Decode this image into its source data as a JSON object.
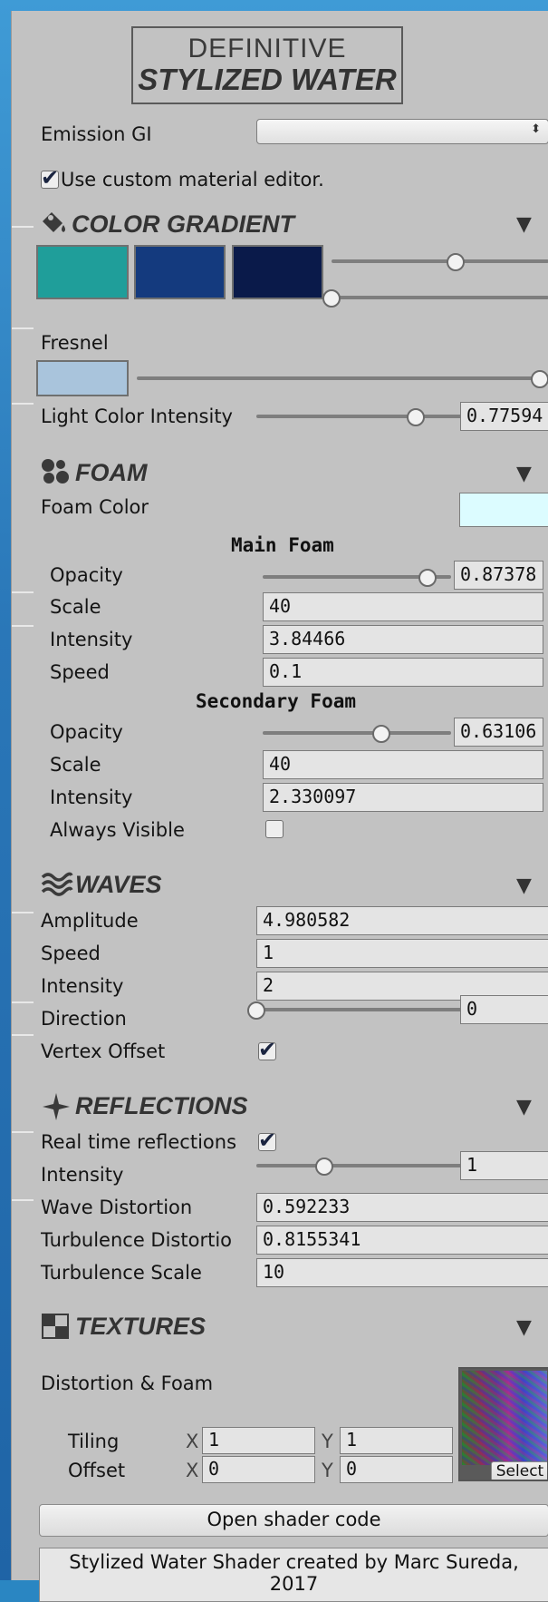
{
  "header": {
    "logo_line1": "DEFINITIVE",
    "logo_line2": "STYLIZED WATER"
  },
  "general": {
    "emission_gi_label": "Emission GI",
    "emission_gi_value": "",
    "custom_editor_label": "Use custom material editor.",
    "custom_editor_checked": true
  },
  "color_gradient": {
    "title": "COLOR GRADIENT",
    "swatches": [
      "#1f9e9a",
      "#143a7e",
      "#0a1a4a"
    ],
    "slider1": 0.57,
    "slider2": 0.0,
    "fresnel_label": "Fresnel",
    "fresnel_color": "#a9c4dc",
    "fresnel_slider": 1.0,
    "light_intensity_label": "Light Color Intensity",
    "light_intensity_value": "0.77594",
    "light_intensity_slider": 0.776
  },
  "foam": {
    "title": "FOAM",
    "color_label": "Foam Color",
    "color": "#dcfcff",
    "main_heading": "Main Foam",
    "main": {
      "opacity_label": "Opacity",
      "opacity_value": "0.87378",
      "opacity_slider": 0.874,
      "scale_label": "Scale",
      "scale_value": "40",
      "intensity_label": "Intensity",
      "intensity_value": "3.84466",
      "speed_label": "Speed",
      "speed_value": "0.1"
    },
    "secondary_heading": "Secondary Foam",
    "secondary": {
      "opacity_label": "Opacity",
      "opacity_value": "0.63106",
      "opacity_slider": 0.631,
      "scale_label": "Scale",
      "scale_value": "40",
      "intensity_label": "Intensity",
      "intensity_value": "2.330097",
      "always_visible_label": "Always Visible",
      "always_visible_checked": false
    }
  },
  "waves": {
    "title": "WAVES",
    "amplitude_label": "Amplitude",
    "amplitude_value": "4.980582",
    "speed_label": "Speed",
    "speed_value": "1",
    "intensity_label": "Intensity",
    "intensity_value": "2",
    "direction_label": "Direction",
    "direction_value": "0",
    "direction_slider": 0.0,
    "vertex_offset_label": "Vertex Offset",
    "vertex_offset_checked": true
  },
  "reflections": {
    "title": "REFLECTIONS",
    "realtime_label": "Real time reflections",
    "realtime_checked": true,
    "intensity_label": "Intensity",
    "intensity_value": "1",
    "intensity_slider": 0.33,
    "wave_distortion_label": "Wave Distortion",
    "wave_distortion_value": "0.592233",
    "turbulence_distortion_label": "Turbulence Distortio",
    "turbulence_distortion_value": "0.8155341",
    "turbulence_scale_label": "Turbulence Scale",
    "turbulence_scale_value": "10"
  },
  "textures": {
    "title": "TEXTURES",
    "distortion_foam_label": "Distortion & Foam",
    "tiling_label": "Tiling",
    "offset_label": "Offset",
    "x_label": "X",
    "y_label": "Y",
    "tiling_x": "1",
    "tiling_y": "1",
    "offset_x": "0",
    "offset_y": "0",
    "select_label": "Select"
  },
  "footer": {
    "open_shader_label": "Open shader code",
    "credit_line1": "Stylized Water Shader created by Marc Sureda,",
    "credit_line2": "2017"
  }
}
